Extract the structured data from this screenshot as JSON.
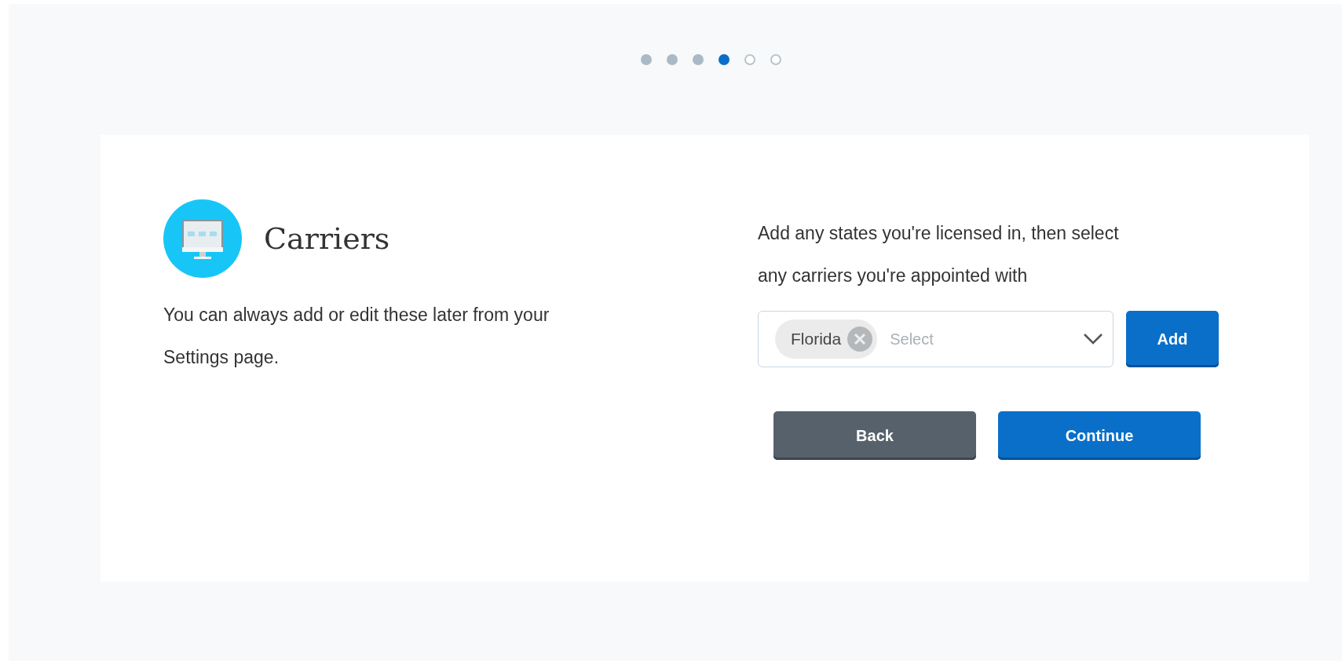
{
  "steps": [
    {
      "completed": true,
      "selected": false
    },
    {
      "completed": true,
      "selected": false
    },
    {
      "completed": true,
      "selected": false
    },
    {
      "completed": false,
      "selected": true
    },
    {
      "completed": false,
      "selected": false
    },
    {
      "completed": false,
      "selected": false
    }
  ],
  "title": "Carriers",
  "description": "You can always add or edit these later from your Settings page.",
  "instructions": "Add any states you're licensed in, then select any carriers you're appointed with",
  "state_select": {
    "chips": [
      "Florida"
    ],
    "placeholder": "Select"
  },
  "add_button": "Add",
  "back_button": "Back",
  "continue_button": "Continue"
}
